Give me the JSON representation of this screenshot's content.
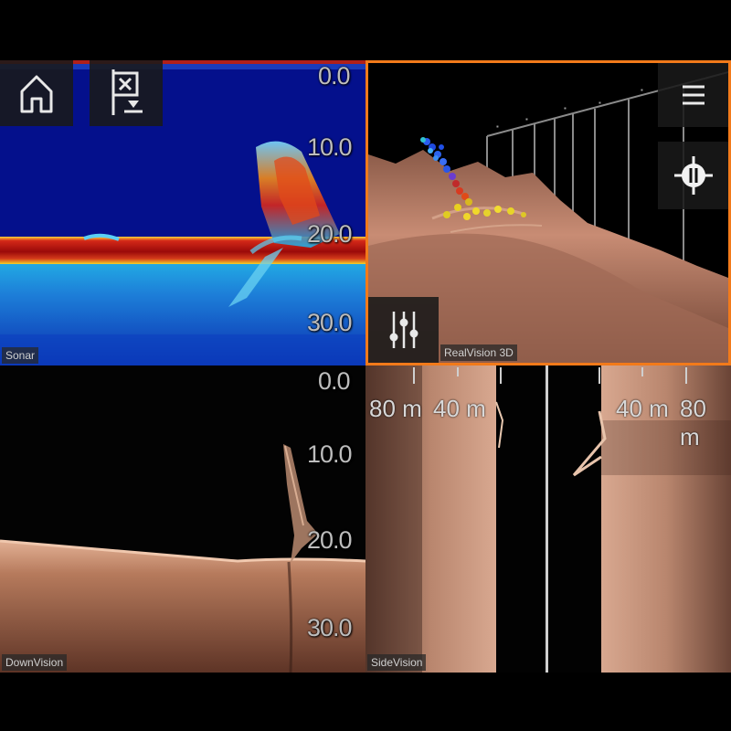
{
  "panes": {
    "sonar": {
      "label": "Sonar",
      "depths": [
        "0.0",
        "10.0",
        "20.0",
        "30.0"
      ]
    },
    "realvision": {
      "label": "RealVision 3D"
    },
    "downvision": {
      "label": "DownVision",
      "depths": [
        "0.0",
        "10.0",
        "20.0",
        "30.0"
      ]
    },
    "sidevision": {
      "label": "SideVision",
      "ranges": [
        "80 m",
        "40 m",
        "40 m",
        "80 m"
      ]
    }
  },
  "icons": {
    "home": "home-icon",
    "waypoint": "waypoint-marker-icon",
    "menu": "menu-icon",
    "cursor": "crosshair-icon",
    "adjust": "sliders-icon"
  },
  "colors": {
    "active_border": "#f27a1a",
    "bottom_echo": "#d32c1c",
    "sonar_water": "#04108c",
    "downvision_seabed": "#b67a5c"
  }
}
